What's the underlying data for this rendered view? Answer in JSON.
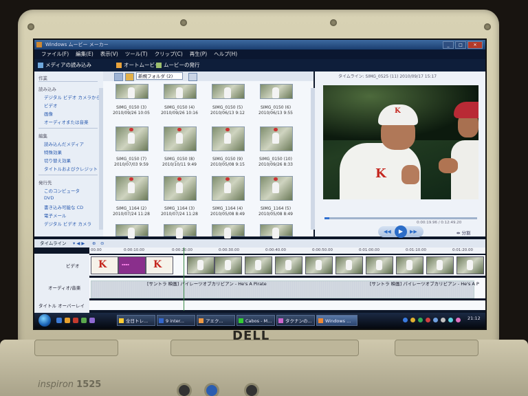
{
  "window": {
    "title": "Windows ムービー メーカー"
  },
  "menu": [
    "ファイル(F)",
    "編集(E)",
    "表示(V)",
    "ツール(T)",
    "クリップ(C)",
    "再生(P)",
    "ヘルプ(H)"
  ],
  "toolbar": {
    "import": "メディアの読み込み",
    "automovie": "オートムービー",
    "publish": "ムービーの発行"
  },
  "tasks": {
    "header": "作業",
    "import_hdr": "読み込み",
    "import_items": [
      "デジタル ビデオ カメラから",
      "ビデオ",
      "画像",
      "オーディオまたは音楽"
    ],
    "edit_hdr": "編集",
    "edit_items": [
      "読み込んだメディア",
      "特殊効果",
      "切り替え効果",
      "タイトルおよびクレジット"
    ],
    "publish_hdr": "発行先",
    "publish_items": [
      "このコンピュータ",
      "DVD",
      "書き込み可能な CD",
      "電子メール",
      "デジタル ビデオ カメラ"
    ]
  },
  "collection": {
    "folder": "新規フォルダ (2)",
    "rows": [
      [
        {
          "name": "SIMG_0150 (3)",
          "date": "2010/09/26 10:05"
        },
        {
          "name": "SIMG_0150 (4)",
          "date": "2010/09/26 10:16"
        },
        {
          "name": "SIMG_0150 (5)",
          "date": "2010/06/13 9:12"
        },
        {
          "name": "SIMG_0150 (6)",
          "date": "2010/06/13 9:55"
        }
      ],
      [
        {
          "name": "SIMG_0150 (7)",
          "date": "2010/07/03 9:59"
        },
        {
          "name": "SIMG_0150 (8)",
          "date": "2010/10/11 9:49"
        },
        {
          "name": "SIMG_0150 (9)",
          "date": "2010/05/08 9:15"
        },
        {
          "name": "SIMG_0150 (10)",
          "date": "2010/09/26 8:33"
        }
      ],
      [
        {
          "name": "SIMG_1164 (2)",
          "date": "2010/07/24 11:28"
        },
        {
          "name": "SIMG_1164 (3)",
          "date": "2010/07/24 11:28"
        },
        {
          "name": "SIMG_1164 (4)",
          "date": "2010/05/08 8:49"
        },
        {
          "name": "SIMG_1164 (5)",
          "date": "2010/05/08 8:49"
        }
      ]
    ]
  },
  "preview": {
    "title": "タイムライン: SIMG_0525 (11) 2010/09/17 15:17",
    "timecode": "0:00:19.96 / 0:12:49.20",
    "split": "分割",
    "progress_pct": 3
  },
  "timeline": {
    "label": "タイムライン",
    "ticks": [
      "00.00",
      "0:00:10.00",
      "0:00:20.00",
      "0:00:30.00",
      "0:00:40.00",
      "0:00:50.00",
      "0:01:00.00",
      "0:01:10.00",
      "0:01:20.00"
    ],
    "video_label": "ビデオ",
    "audio_label": "オーディオ/音楽",
    "title_label": "タイトル オーバーレイ",
    "audio_clip1": "[サントラ 映画] パイレーツオブカリビアン - He's A Pirate",
    "audio_clip2": "[サントラ 映画] パイレーツオブカリビアン - He's A P"
  },
  "taskbar": {
    "items": [
      "全日トレ...",
      "9 inter...",
      "アエク...",
      "Cabos - M...",
      "タクナンの...",
      "Windows ..."
    ],
    "clock": "21:12"
  },
  "device": {
    "brand": "DELL",
    "model": "inspiron",
    "model_num": "1525"
  }
}
